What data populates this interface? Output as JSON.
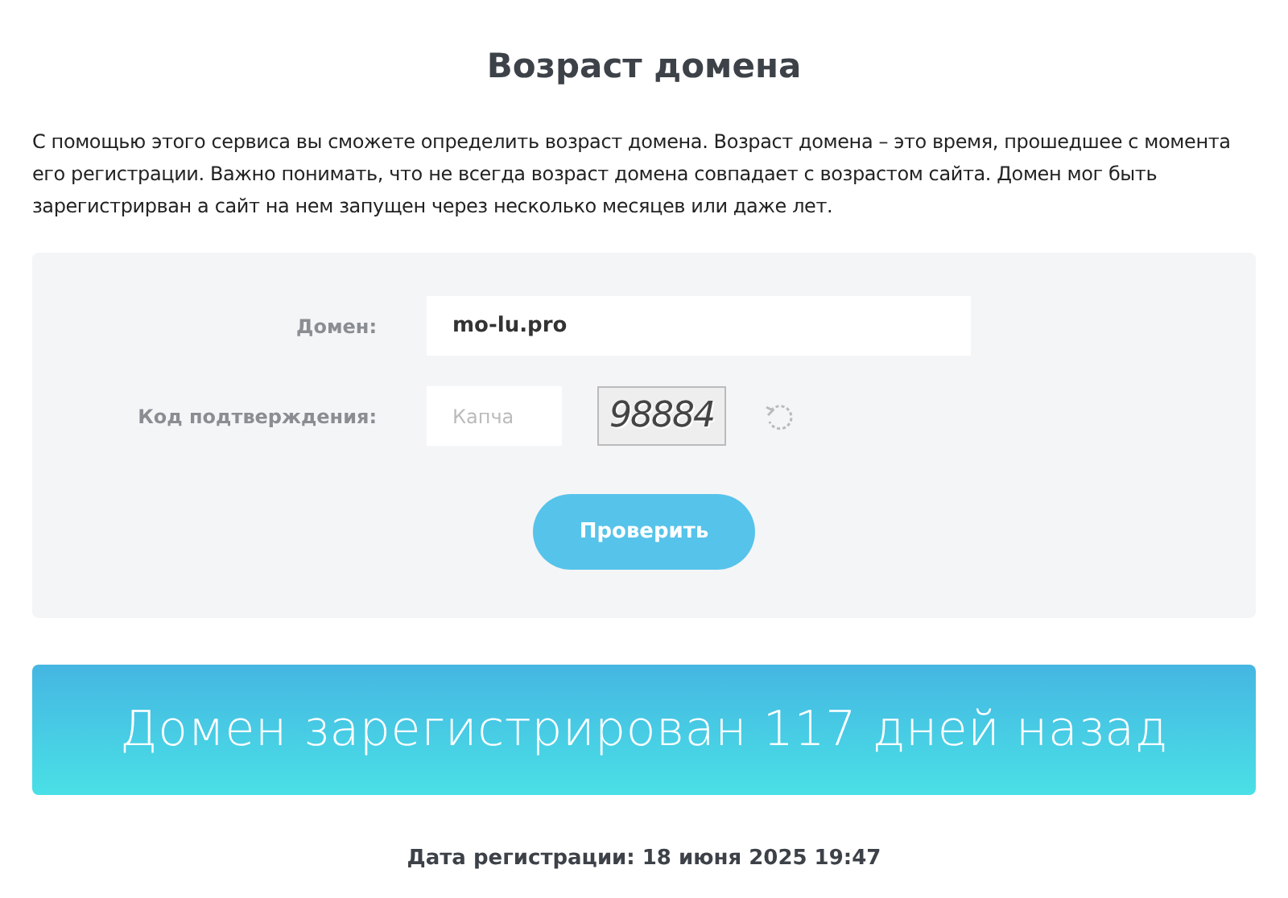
{
  "title": "Возраст домена",
  "description": "С помощью этого сервиса вы сможете определить возраст домена. Возраст домена – это время, прошедшее с момента его регистрации. Важно понимать, что не всегда возраст домена совпадает с возрастом сайта. Домен мог быть зарегистрирван а сайт на нем запущен через несколько месяцев или даже лет.",
  "form": {
    "domain": {
      "label": "Домен:",
      "value": "mo-lu.pro"
    },
    "captcha": {
      "label": "Код подтверждения:",
      "placeholder": "Капча",
      "image_text": "98884"
    },
    "submit": "Проверить"
  },
  "result": {
    "headline": "Домен зарегистрирован 117 дней назад",
    "date": "Дата регистрации: 18 июня 2025 19:47"
  }
}
